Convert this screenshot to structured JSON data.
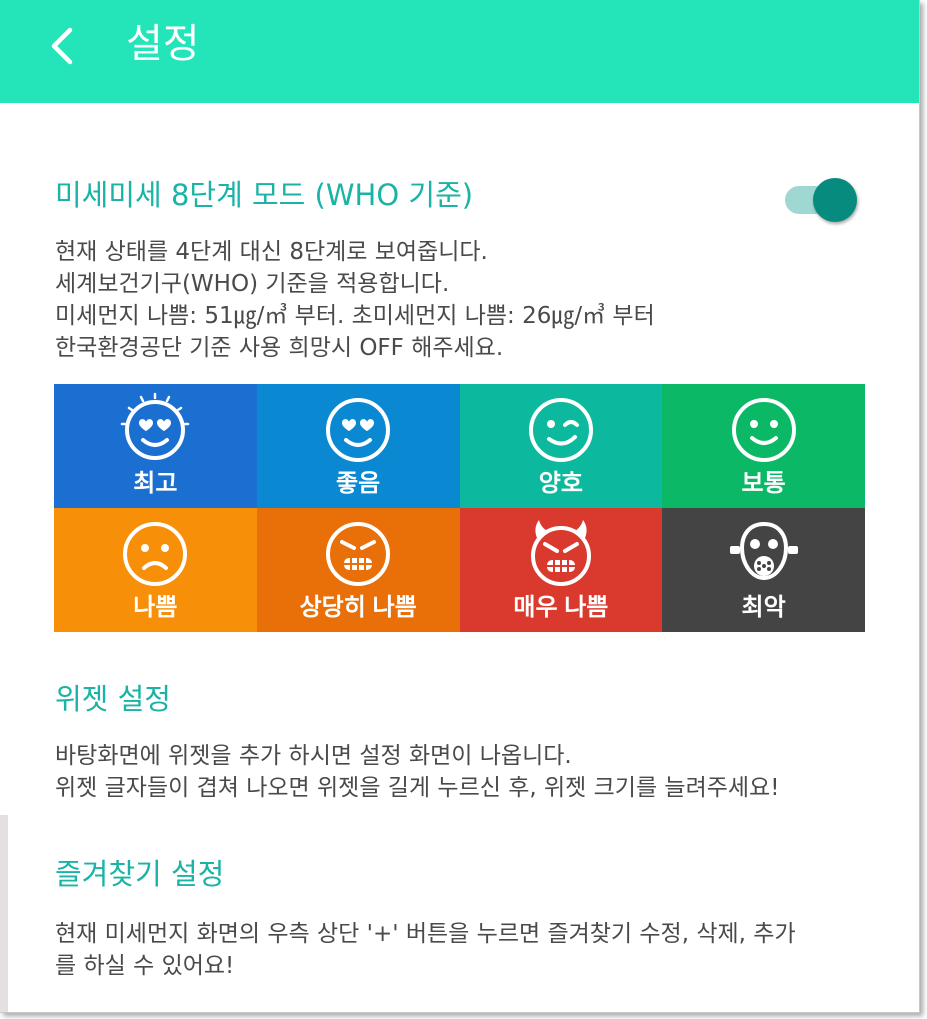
{
  "appbar": {
    "title": "설정",
    "back_icon": "chevron-left-icon",
    "color": "#24e4ba"
  },
  "who_mode": {
    "title": "미세미세 8단계 모드 (WHO 기준)",
    "enabled": true,
    "description": [
      "현재 상태를 4단계 대신 8단계로 보여줍니다.",
      "세계보건기구(WHO) 기준을 적용합니다.",
      "미세먼지 나쁨: 51㎍/㎥ 부터. 초미세먼지 나쁨: 26㎍/㎥ 부터",
      "한국환경공단 기준 사용 희망시 OFF 해주세요."
    ]
  },
  "levels": [
    {
      "label": "최고",
      "color": "#1a6fd1",
      "icon": "heart-eyes-sparkle-face-icon"
    },
    {
      "label": "좋음",
      "color": "#0b88d2",
      "icon": "heart-eyes-face-icon"
    },
    {
      "label": "양호",
      "color": "#0cb99e",
      "icon": "wink-face-icon"
    },
    {
      "label": "보통",
      "color": "#0bb866",
      "icon": "smile-face-icon"
    },
    {
      "label": "나쁨",
      "color": "#f88f08",
      "icon": "frown-face-icon"
    },
    {
      "label": "상당히 나쁨",
      "color": "#e96f08",
      "icon": "grimace-face-icon"
    },
    {
      "label": "매우 나쁨",
      "color": "#d93a2d",
      "icon": "devil-face-icon"
    },
    {
      "label": "최악",
      "color": "#444444",
      "icon": "gas-mask-icon"
    }
  ],
  "widget": {
    "title": "위젯 설정",
    "description": [
      "바탕화면에 위젯을 추가 하시면 설정 화면이 나옵니다.",
      "위젯 글자들이 겹쳐 나오면 위젯을 길게 누르신 후, 위젯 크기를 늘려주세요!"
    ]
  },
  "favorites": {
    "title": "즐겨찾기 설정",
    "description": [
      "현재 미세먼지 화면의 우측 상단 '+' 버튼을 누르면 즐겨찾기 수정, 삭제, 추가",
      "를 하실 수 있어요!"
    ]
  },
  "accent_color": "#1ab3a6"
}
